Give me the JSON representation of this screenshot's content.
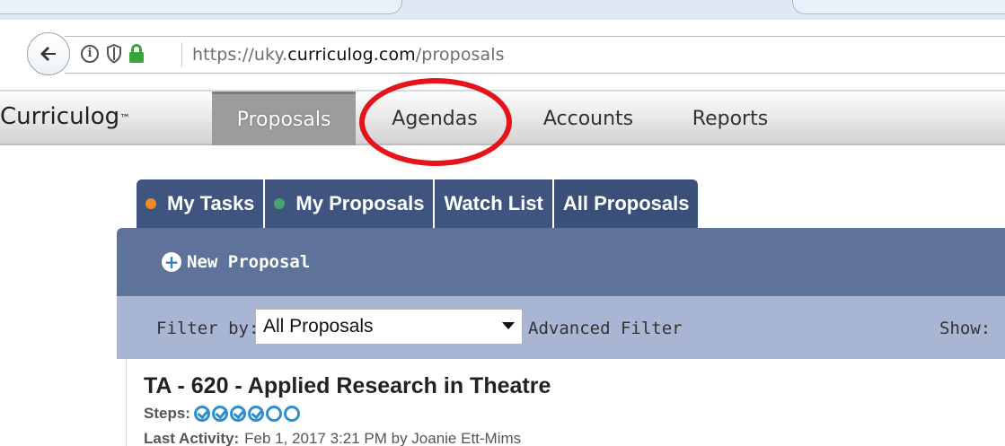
{
  "browser": {
    "url_prefix": "https://uky.",
    "url_domain": "curriculog.com",
    "url_path": "/proposals"
  },
  "app": {
    "logo": "Curriculog",
    "logo_mark": "™",
    "nav": [
      {
        "label": "Proposals",
        "active": true
      },
      {
        "label": "Agendas",
        "active": false
      },
      {
        "label": "Accounts",
        "active": false
      },
      {
        "label": "Reports",
        "active": false
      }
    ]
  },
  "subtabs": [
    {
      "label": "My Tasks",
      "dot": "orange"
    },
    {
      "label": "My Proposals",
      "dot": "green"
    },
    {
      "label": "Watch List",
      "dot": ""
    },
    {
      "label": "All Proposals",
      "dot": ""
    }
  ],
  "toolbar": {
    "new_proposal_label": "New Proposal"
  },
  "filter": {
    "label": "Filter by:",
    "selected": "All Proposals",
    "advanced_label": "Advanced Filter",
    "show_label": "Show:"
  },
  "proposal": {
    "title": "TA - 620 - Applied Research in Theatre",
    "steps_label": "Steps:",
    "steps_completed": 4,
    "steps_total": 6,
    "activity_label": "Last Activity:",
    "activity_value": "Feb 1, 2017 3:21 PM by Joanie Ett-Mims"
  },
  "colors": {
    "annotation_ring": "#e5141a",
    "subtab_bg": "#3f5580",
    "panel_bg": "#5f7299",
    "filter_bg": "#a9b6d3",
    "step_blue": "#2f8fce"
  },
  "icons": [
    "back-arrow-icon",
    "info-icon",
    "shield-icon",
    "lock-icon",
    "plus-icon",
    "dropdown-arrow-icon",
    "step-check-icon"
  ]
}
